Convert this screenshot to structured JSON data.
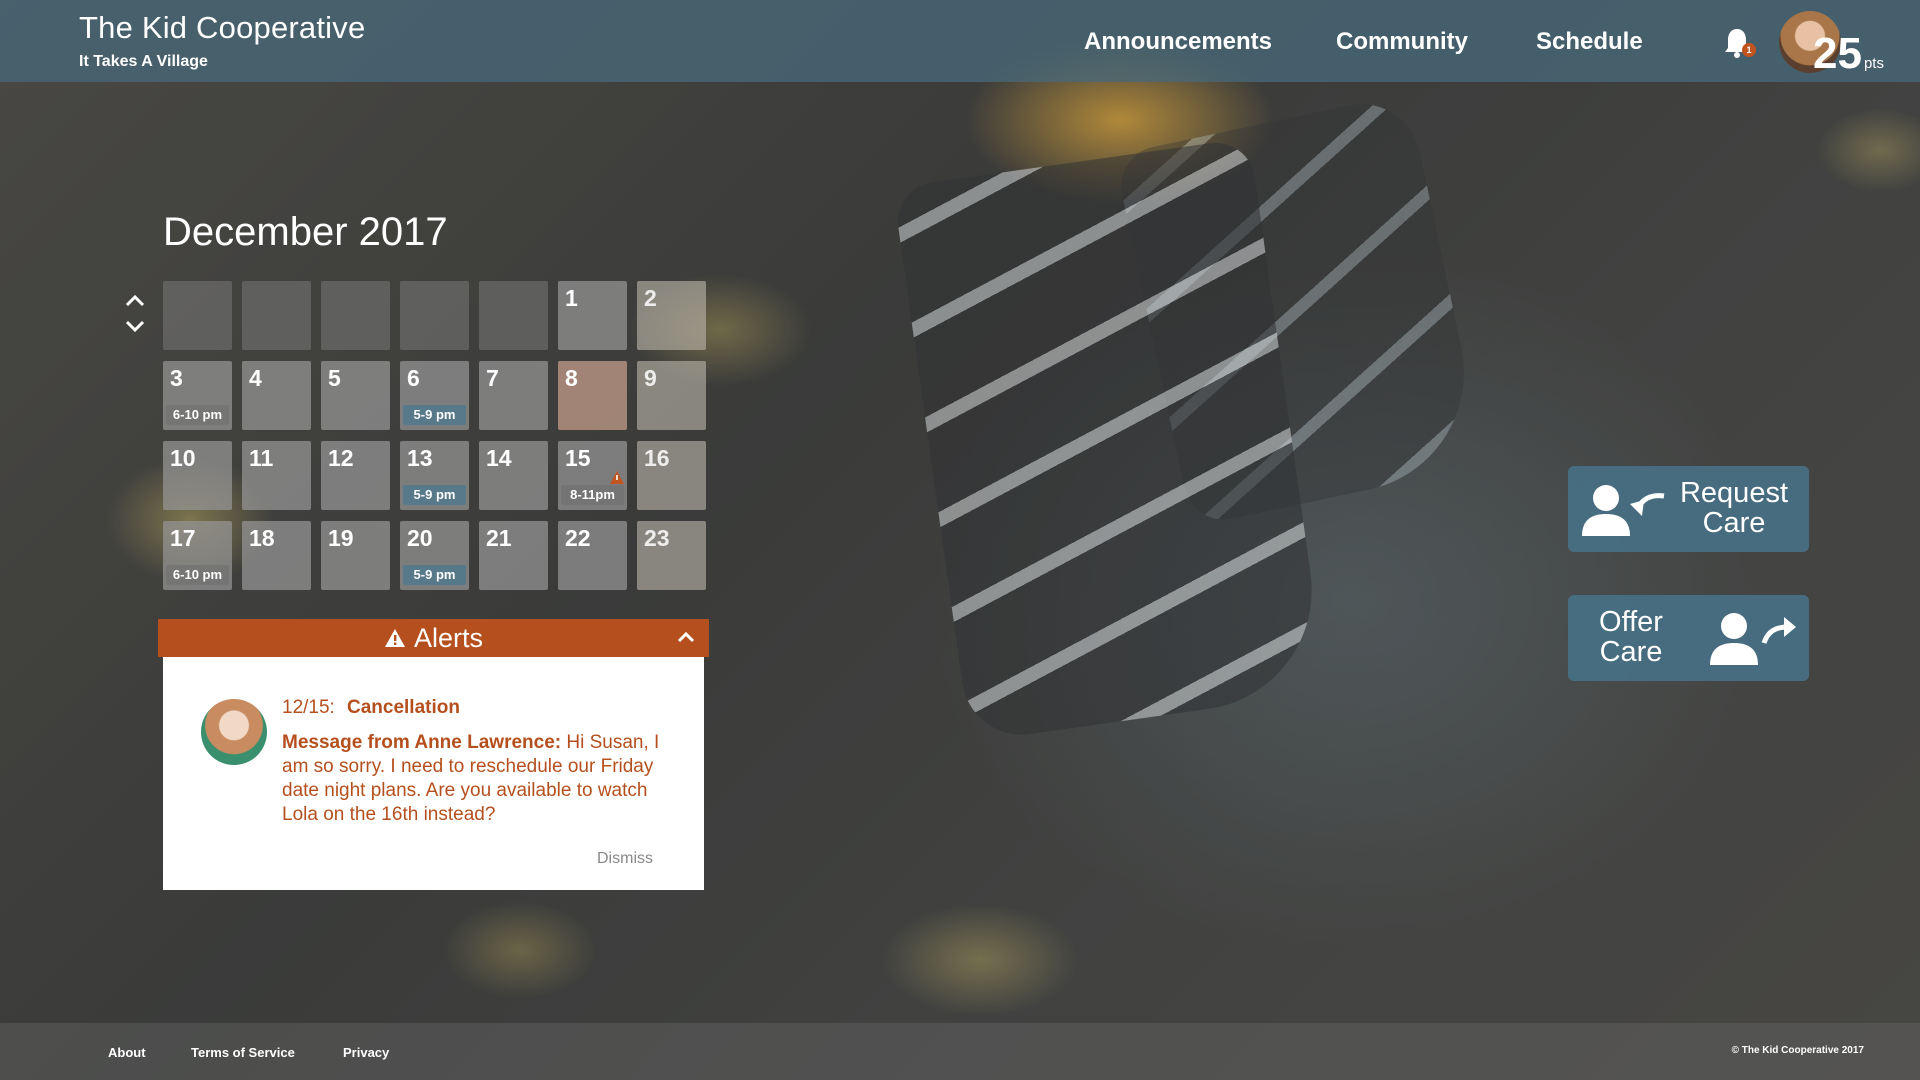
{
  "app": {
    "title": "The Kid Cooperative",
    "tagline": "It Takes A Village"
  },
  "nav": {
    "announcements": "Announcements",
    "community": "Community",
    "schedule": "Schedule",
    "notifications_count": "1",
    "points_value": "25",
    "points_unit": "pts"
  },
  "calendar": {
    "month_label": "December 2017",
    "leading_blanks": 5,
    "days": [
      {
        "day": "1",
        "state": "normal"
      },
      {
        "day": "2",
        "state": "dim"
      },
      {
        "day": "3",
        "event": "6-10 pm",
        "event_style": "plain"
      },
      {
        "day": "4"
      },
      {
        "day": "5"
      },
      {
        "day": "6",
        "event": "5-9 pm",
        "event_style": "blue"
      },
      {
        "day": "7"
      },
      {
        "day": "8",
        "state": "highlight"
      },
      {
        "day": "9",
        "state": "dim"
      },
      {
        "day": "10"
      },
      {
        "day": "11"
      },
      {
        "day": "12"
      },
      {
        "day": "13",
        "event": "5-9 pm",
        "event_style": "blue"
      },
      {
        "day": "14"
      },
      {
        "day": "15",
        "event": "8-11pm",
        "event_style": "plain",
        "warning": true
      },
      {
        "day": "16",
        "state": "dim"
      },
      {
        "day": "17",
        "event": "6-10 pm",
        "event_style": "plain"
      },
      {
        "day": "18"
      },
      {
        "day": "19"
      },
      {
        "day": "20",
        "event": "5-9 pm",
        "event_style": "blue"
      },
      {
        "day": "21"
      },
      {
        "day": "22"
      },
      {
        "day": "23",
        "state": "dim"
      }
    ]
  },
  "alerts": {
    "title": "Alerts",
    "item": {
      "date": "12/15:",
      "type": "Cancellation",
      "from_label": "Message from Anne Lawrence:",
      "message": "Hi Susan, I am so sorry. I need to reschedule our Friday date night plans. Are you available to watch Lola on the 16th instead?",
      "dismiss": "Dismiss"
    }
  },
  "actions": {
    "request_care": "Request Care",
    "offer_care": "Offer Care"
  },
  "footer": {
    "about": "About",
    "terms": "Terms of Service",
    "privacy": "Privacy",
    "copyright": "© The Kid Cooperative 2017"
  },
  "colors": {
    "header_bg": "#486878",
    "accent": "#b5501e",
    "care_button": "#487084"
  }
}
